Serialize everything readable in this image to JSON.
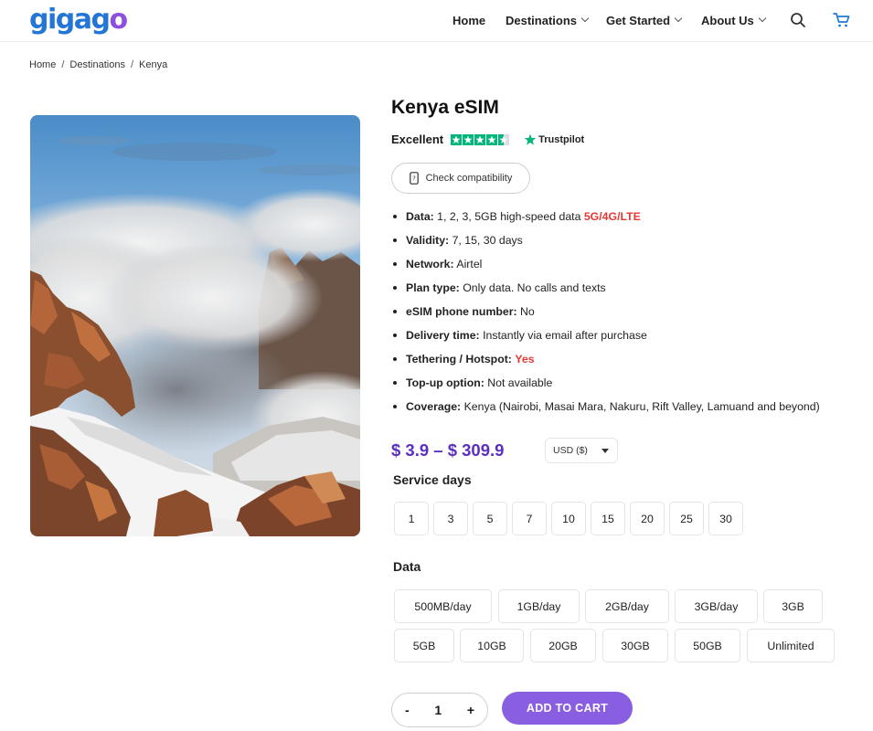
{
  "header": {
    "logo": {
      "text_main": "gigag",
      "text_last": "o"
    },
    "nav": [
      {
        "label": "Home",
        "has_dropdown": false
      },
      {
        "label": "Destinations",
        "has_dropdown": true
      },
      {
        "label": "Get Started",
        "has_dropdown": true
      },
      {
        "label": "About Us",
        "has_dropdown": true
      }
    ],
    "icons": [
      "search-icon",
      "cart-icon"
    ]
  },
  "breadcrumb": [
    "Home",
    "Destinations",
    "Kenya"
  ],
  "product": {
    "title": "Kenya eSIM",
    "rating_text": "Excellent",
    "rating_stars": 4.5,
    "trustpilot_label": "Trustpilot",
    "compat_label": "Check compatibility",
    "features": [
      {
        "label": "Data:",
        "value": "1, 2, 3, 5GB high-speed data",
        "highlight": "5G/4G/LTE"
      },
      {
        "label": "Validity:",
        "value": "7, 15, 30 days"
      },
      {
        "label": "Network:",
        "value": "Airtel"
      },
      {
        "label": "Plan type:",
        "value": "Only data. No calls and texts"
      },
      {
        "label": "eSIM phone number:",
        "value": "No"
      },
      {
        "label": "Delivery time:",
        "value": "Instantly via email after purchase"
      },
      {
        "label": "Tethering / Hotspot:",
        "highlight": "Yes"
      },
      {
        "label": "Top-up option:",
        "value": "Not available"
      },
      {
        "label": "Coverage:",
        "value": "Kenya (Nairobi, Masai Mara, Nakuru, Rift Valley, Lamuand and beyond)"
      }
    ],
    "price": "$ 3.9 – $ 309.9",
    "currency": "USD ($)",
    "service_days_label": "Service days",
    "service_days": [
      "1",
      "3",
      "5",
      "7",
      "10",
      "15",
      "20",
      "25",
      "30"
    ],
    "data_label": "Data",
    "data_row1": [
      "500MB/day",
      "1GB/day",
      "2GB/day",
      "3GB/day",
      "3GB"
    ],
    "data_row2": [
      "5GB",
      "10GB",
      "20GB",
      "30GB",
      "50GB",
      "Unlimited"
    ],
    "quantity": {
      "minus": "-",
      "value": "1",
      "plus": "+"
    },
    "add_to_cart": "ADD TO CART"
  },
  "colors": {
    "brand_blue": "#2476d6",
    "brand_purple": "#8e4fe0",
    "price_purple": "#5b2fbf",
    "cart_button": "#8a5ee0",
    "highlight_red": "#e53935",
    "trustpilot_green": "#00b67a"
  }
}
